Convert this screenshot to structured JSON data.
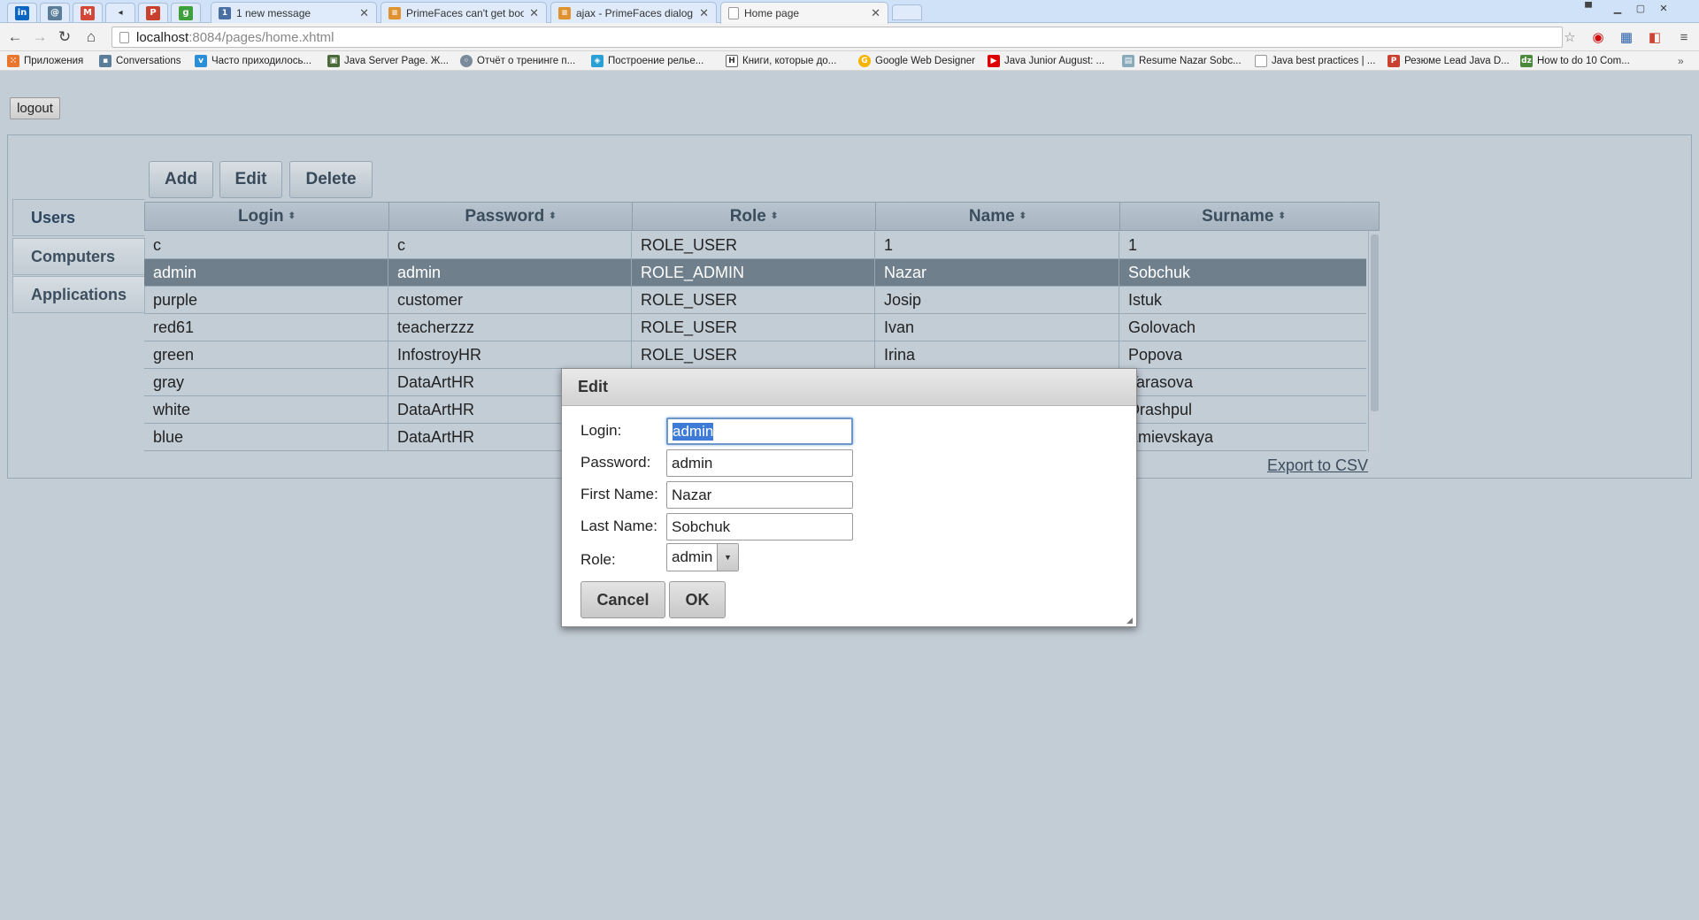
{
  "browser": {
    "tabs": [
      {
        "title": "1 new message"
      },
      {
        "title": "PrimeFaces can't get bool"
      },
      {
        "title": "ajax - PrimeFaces dialog d"
      },
      {
        "title": "Home page"
      }
    ],
    "url_host": "localhost",
    "url_rest": ":8084/pages/home.xhtml",
    "bookmarks": [
      "Приложения",
      "Conversations",
      "Часто приходилось...",
      "Java Server Page. Ж...",
      "Отчёт о тренинге п...",
      "Построение релье...",
      "Книги, которые до...",
      "Google Web Designer",
      "Java Junior August: ...",
      "Resume Nazar Sobc...",
      "Java best practices | ...",
      "Резюме Lead Java D...",
      "How to do 10 Com..."
    ]
  },
  "page": {
    "logout_label": "logout",
    "side_tabs": [
      "Users",
      "Computers",
      "Applications"
    ],
    "actions": {
      "add": "Add",
      "edit": "Edit",
      "delete": "Delete"
    },
    "table": {
      "columns": [
        "Login",
        "Password",
        "Role",
        "Name",
        "Surname"
      ],
      "rows": [
        [
          "c",
          "c",
          "ROLE_USER",
          "1",
          "1"
        ],
        [
          "admin",
          "admin",
          "ROLE_ADMIN",
          "Nazar",
          "Sobchuk"
        ],
        [
          "purple",
          "customer",
          "ROLE_USER",
          "Josip",
          "Istuk"
        ],
        [
          "red61",
          "teacherzzz",
          "ROLE_USER",
          "Ivan",
          "Golovach"
        ],
        [
          "green",
          "InfostroyHR",
          "ROLE_USER",
          "Irina",
          "Popova"
        ],
        [
          "gray",
          "DataArtHR",
          "",
          "",
          "Tarasova"
        ],
        [
          "white",
          "DataArtHR",
          "",
          "",
          "Drashpul"
        ],
        [
          "blue",
          "DataArtHR",
          "",
          "",
          "Zmievskaya"
        ]
      ],
      "selected_row": 1
    },
    "export_label": "Export to CSV"
  },
  "dialog": {
    "title": "Edit",
    "labels": {
      "login": "Login:",
      "password": "Password:",
      "first_name": "First Name:",
      "last_name": "Last Name:",
      "role": "Role:"
    },
    "values": {
      "login": "admin",
      "password": "admin",
      "first_name": "Nazar",
      "last_name": "Sobchuk",
      "role": "admin"
    },
    "cancel_label": "Cancel",
    "ok_label": "OK"
  },
  "colors": {
    "page_bg": "#c3cdd6",
    "selected_row": "#6f7f8b",
    "selection_highlight": "#3d7bd6"
  }
}
